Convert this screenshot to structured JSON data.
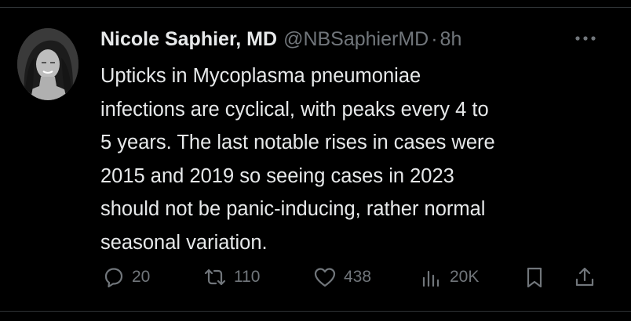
{
  "tweet": {
    "author_name": "Nicole Saphier, MD",
    "handle": "@NBSaphierMD",
    "separator": "·",
    "time": "8h",
    "text": "Upticks in Mycoplasma pneumoniae\ninfections are cyclical, with peaks every 4 to\n5 years. The last notable rises in cases were\n2015 and 2019 so seeing cases in 2023\nshould not be panic-inducing, rather normal\nseasonal variation.",
    "more_icon": "more-horizontal-icon"
  },
  "actions": {
    "reply": {
      "icon": "reply-icon",
      "count": "20"
    },
    "retweet": {
      "icon": "retweet-icon",
      "count": "110"
    },
    "like": {
      "icon": "heart-icon",
      "count": "438"
    },
    "views": {
      "icon": "views-icon",
      "count": "20K"
    },
    "bookmark": {
      "icon": "bookmark-icon"
    },
    "share": {
      "icon": "share-icon"
    }
  },
  "colors": {
    "background": "#000000",
    "text_primary": "#e7e9ea",
    "text_secondary": "#71767b",
    "divider": "#2f3336"
  }
}
